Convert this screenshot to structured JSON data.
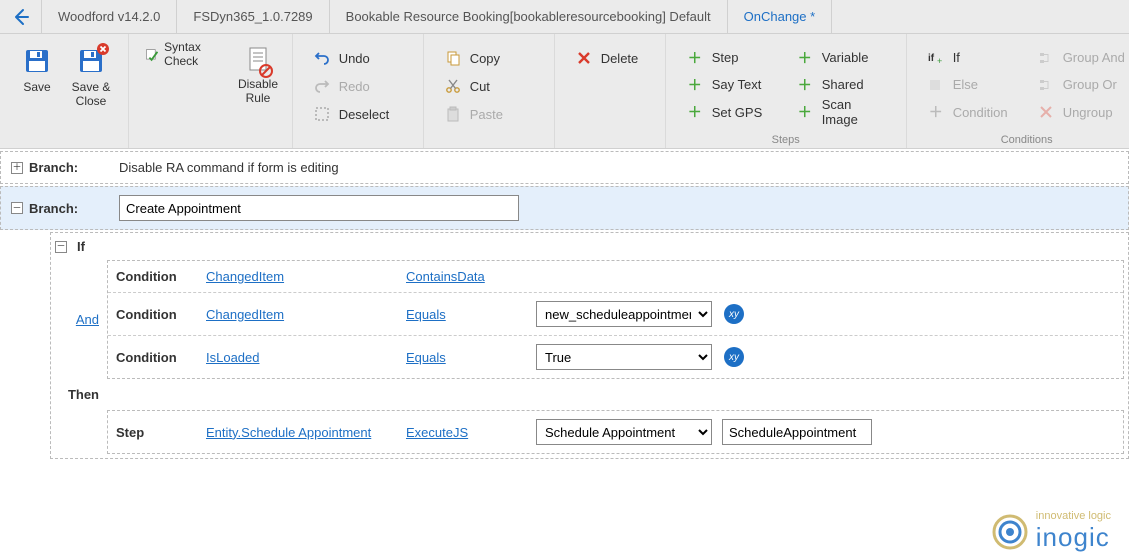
{
  "breadcrumb": {
    "back": "←",
    "items": [
      "Woodford v14.2.0",
      "FSDyn365_1.0.7289",
      "Bookable Resource Booking[bookableresourcebooking] Default",
      "OnChange *"
    ]
  },
  "ribbon": {
    "save": "Save",
    "saveClose": "Save & Close",
    "syntaxCheck": "Syntax Check",
    "disableRule": "Disable Rule",
    "undo": "Undo",
    "redo": "Redo",
    "deselect": "Deselect",
    "copy": "Copy",
    "cut": "Cut",
    "paste": "Paste",
    "delete": "Delete",
    "step": "Step",
    "sayText": "Say Text",
    "setGps": "Set GPS",
    "variable": "Variable",
    "shared": "Shared",
    "scanImage": "Scan Image",
    "if": "If",
    "else": "Else",
    "condition": "Condition",
    "groupAnd": "Group And",
    "groupOr": "Group Or",
    "ungroup": "Ungroup",
    "stepsLabel": "Steps",
    "conditionsLabel": "Conditions"
  },
  "branch1": {
    "label": "Branch:",
    "text": "Disable RA command if form is editing"
  },
  "branch2": {
    "label": "Branch:",
    "value": "Create Appointment"
  },
  "ifBlock": {
    "ifLabel": "If",
    "andLabel": "And",
    "thenLabel": "Then",
    "conditions": [
      {
        "type": "Condition",
        "field": "ChangedItem",
        "op": "ContainsData",
        "val": null,
        "fx": false
      },
      {
        "type": "Condition",
        "field": "ChangedItem",
        "op": "Equals",
        "val": "new_scheduleappointment",
        "fx": true
      },
      {
        "type": "Condition",
        "field": "IsLoaded",
        "op": "Equals",
        "val": "True",
        "fx": true
      }
    ],
    "step": {
      "type": "Step",
      "field": "Entity.Schedule Appointment",
      "op": "ExecuteJS",
      "val": "Schedule Appointment",
      "text": "ScheduleAppointment"
    }
  },
  "logo": {
    "tag": "innovative logic",
    "name": "inogic"
  }
}
